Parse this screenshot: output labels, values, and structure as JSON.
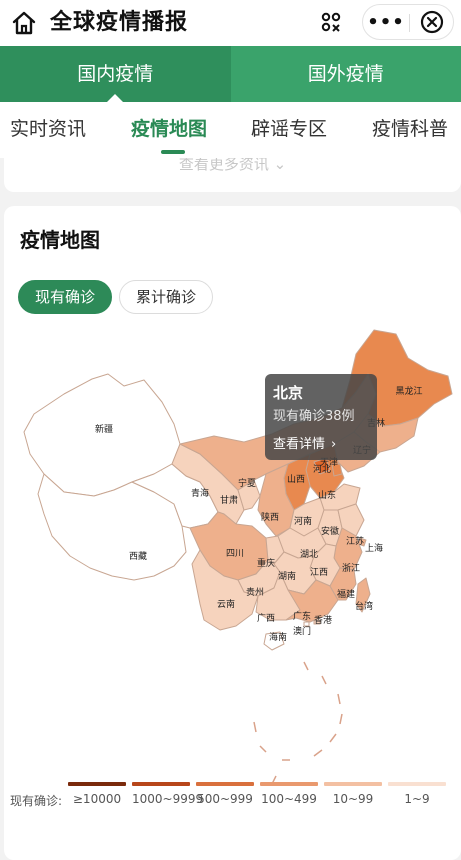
{
  "app": {
    "title": "全球疫情播报"
  },
  "capsule": {
    "more_glyph": "•••"
  },
  "region_tabs": [
    {
      "label": "国内疫情",
      "active": true
    },
    {
      "label": "国外疫情",
      "active": false
    }
  ],
  "section_tabs": [
    {
      "label": "实时资讯",
      "active": false
    },
    {
      "label": "疫情地图",
      "active": true
    },
    {
      "label": "辟谣专区",
      "active": false
    },
    {
      "label": "疫情科普",
      "active": false
    }
  ],
  "prev_card": {
    "more_link": "查看更多资讯 ⌄"
  },
  "map_card": {
    "title": "疫情地图",
    "toggles": [
      {
        "label": "现有确诊",
        "active": true
      },
      {
        "label": "累计确诊",
        "active": false
      }
    ]
  },
  "tooltip": {
    "province": "北京",
    "count_text": "现有确诊38例",
    "link": "查看详情"
  },
  "provinces": [
    {
      "name": "新疆",
      "level": 0
    },
    {
      "name": "西藏",
      "level": 0
    },
    {
      "name": "青海",
      "level": 0
    },
    {
      "name": "甘肃",
      "level": 1
    },
    {
      "name": "宁夏",
      "level": 1
    },
    {
      "name": "内蒙古",
      "level": 2
    },
    {
      "name": "黑龙江",
      "level": 3
    },
    {
      "name": "吉林",
      "level": 2
    },
    {
      "name": "辽宁",
      "level": 2
    },
    {
      "name": "河北",
      "level": 3
    },
    {
      "name": "天津",
      "level": 3
    },
    {
      "name": "北京",
      "level": 4
    },
    {
      "name": "山西",
      "level": 3
    },
    {
      "name": "山东",
      "level": 1
    },
    {
      "name": "陕西",
      "level": 2
    },
    {
      "name": "河南",
      "level": 1
    },
    {
      "name": "四川",
      "level": 2
    },
    {
      "name": "重庆",
      "level": 1
    },
    {
      "name": "湖北",
      "level": 1
    },
    {
      "name": "安徽",
      "level": 1
    },
    {
      "name": "江苏",
      "level": 1
    },
    {
      "name": "上海",
      "level": 2
    },
    {
      "name": "浙江",
      "level": 2
    },
    {
      "name": "江西",
      "level": 1
    },
    {
      "name": "湖南",
      "level": 1
    },
    {
      "name": "贵州",
      "level": 1
    },
    {
      "name": "云南",
      "level": 1
    },
    {
      "name": "广西",
      "level": 1
    },
    {
      "name": "广东",
      "level": 2
    },
    {
      "name": "福建",
      "level": 2
    },
    {
      "name": "台湾",
      "level": 2
    },
    {
      "name": "香港",
      "level": 1
    },
    {
      "name": "澳门",
      "level": 0
    },
    {
      "name": "海南",
      "level": 0
    }
  ],
  "legend": {
    "label": "现有确诊:",
    "items": [
      {
        "range": "≥10000",
        "color": "#7a2a0c"
      },
      {
        "range": "1000~9999",
        "color": "#b7461a"
      },
      {
        "range": "500~999",
        "color": "#d9703d"
      },
      {
        "range": "100~499",
        "color": "#e9996e"
      },
      {
        "range": "10~99",
        "color": "#f3c0a2"
      },
      {
        "range": "1~9",
        "color": "#f9e0d1"
      }
    ]
  },
  "level_colors": [
    "#ffffff",
    "#f6d3bd",
    "#eeb08c",
    "#e8894f",
    "#e2682b"
  ],
  "brand": {
    "green": "#3aa36b",
    "green_dark": "#2d8a58"
  }
}
